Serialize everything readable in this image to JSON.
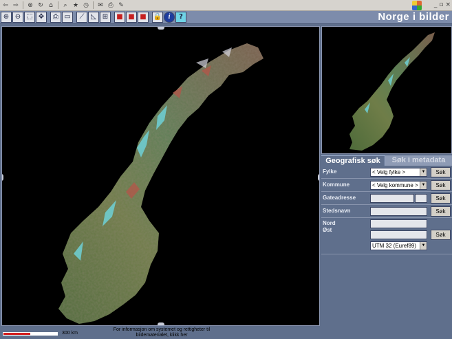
{
  "app": {
    "title": "Norge i bilder"
  },
  "icons": [
    "back-icon",
    "forward-icon",
    "stop-icon",
    "refresh-icon",
    "home-icon",
    "search-icon",
    "favorites-icon",
    "history-icon",
    "mail-icon",
    "print-icon",
    "edit-icon"
  ],
  "toolbar": {
    "tools": [
      {
        "name": "zoom-in-tool",
        "glyph": "⊕"
      },
      {
        "name": "zoom-out-tool",
        "glyph": "⊖"
      },
      {
        "name": "zoom-window-tool",
        "glyph": "⬚"
      },
      {
        "name": "pan-tool",
        "glyph": "✥"
      },
      {
        "name": "print-tool",
        "glyph": "⎙"
      },
      {
        "name": "full-extent-tool",
        "glyph": "▭"
      },
      {
        "name": "measure-line-tool",
        "glyph": "⟋"
      },
      {
        "name": "measure-area-tool",
        "glyph": "◺"
      },
      {
        "name": "coordinate-tool",
        "glyph": "⊞"
      },
      {
        "name": "layer-red-tool",
        "glyph": "■"
      },
      {
        "name": "layer-green-tool",
        "glyph": "■"
      },
      {
        "name": "layer-blue-tool",
        "glyph": "■"
      },
      {
        "name": "lock-tool",
        "glyph": "🔒"
      },
      {
        "name": "info-tool",
        "glyph": "i"
      },
      {
        "name": "help-tool",
        "glyph": "?"
      }
    ]
  },
  "footer": {
    "scale_label": "300 km",
    "info_text": "For informasjon om systemet og rettigheter til bildematerialet, klikk her"
  },
  "tabs": [
    {
      "label": "Geografisk søk",
      "active": true
    },
    {
      "label": "Søk i metadata",
      "active": false
    }
  ],
  "search": {
    "fylke": {
      "label": "Fylke",
      "value": "< Velg fylke >",
      "button": "Søk"
    },
    "kommune": {
      "label": "Kommune",
      "value": "< Velg kommune >",
      "button": "Søk"
    },
    "gateadresse": {
      "label": "Gateadresse",
      "value": "",
      "number": "",
      "button": "Søk"
    },
    "stedsnavn": {
      "label": "Stedsnavn",
      "value": "",
      "button": "Søk"
    },
    "koordinat": {
      "nord_label": "Nord",
      "ost_label": "Øst",
      "nord_value": "",
      "ost_value": "",
      "projection": "UTM 32 (Euref89)",
      "button": "Søk"
    }
  },
  "colors": {
    "accent": "#7d8cab",
    "panel": "#5f6f8c",
    "title": "#ffffff",
    "scale_red": "#d31d1d"
  }
}
